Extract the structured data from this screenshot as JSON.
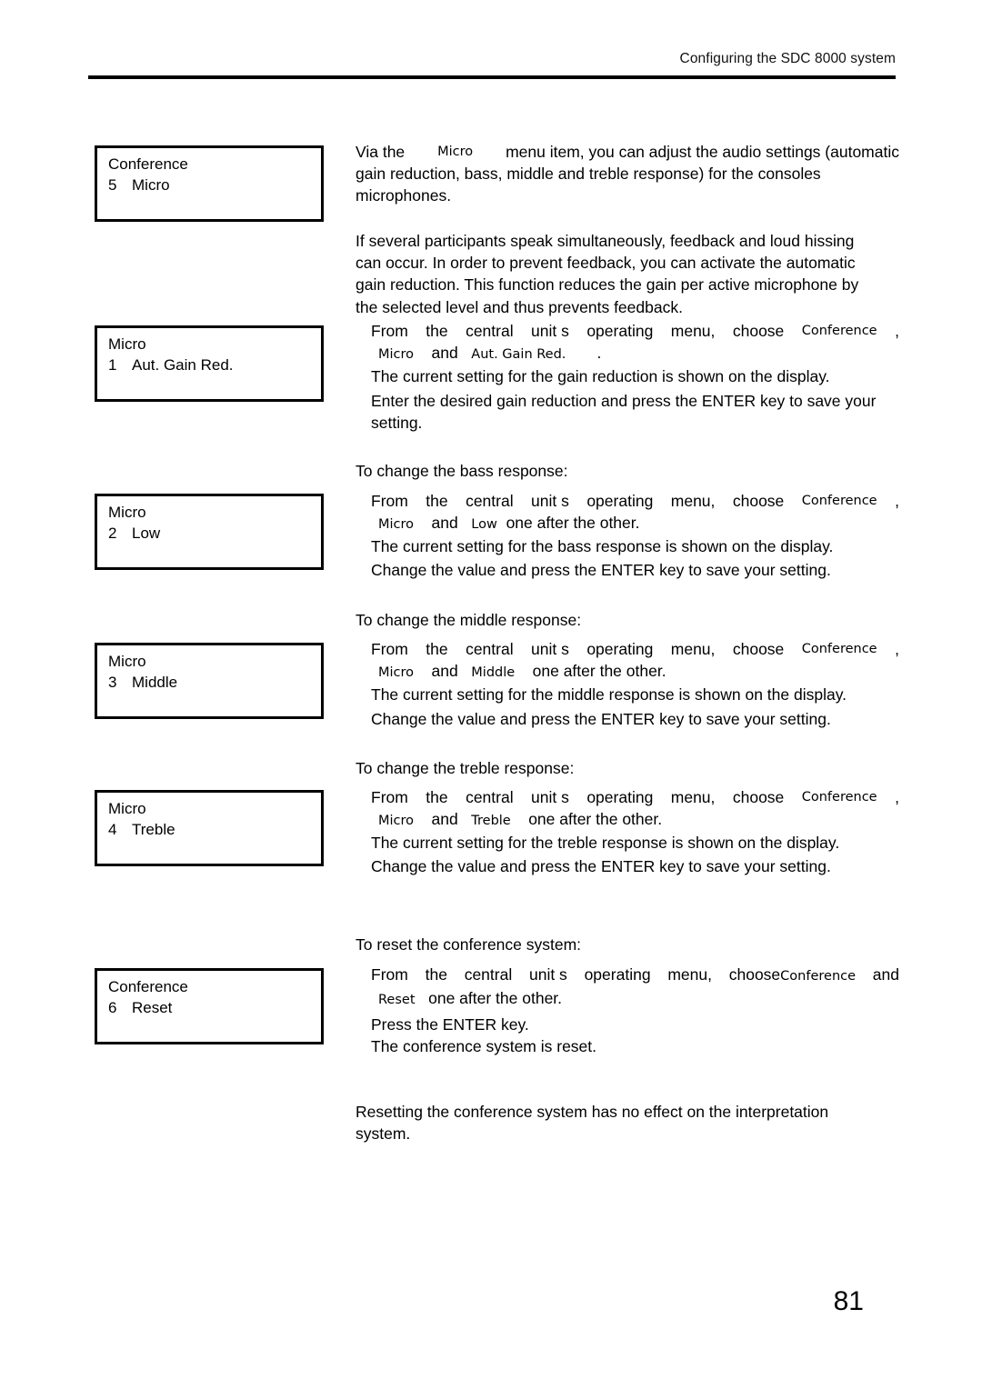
{
  "header": {
    "running_title": "Configuring the SDC 8000 system"
  },
  "page_number": "81",
  "displays": [
    {
      "name": "display-conference-micro",
      "line1": "Conference",
      "index": "5",
      "label": "Micro"
    },
    {
      "name": "display-micro-aut-gain-red",
      "line1": "Micro",
      "index": "1",
      "label": "Aut. Gain Red."
    },
    {
      "name": "display-micro-low",
      "line1": "Micro",
      "index": "2",
      "label": "Low"
    },
    {
      "name": "display-micro-middle",
      "line1": "Micro",
      "index": "3",
      "label": "Middle"
    },
    {
      "name": "display-micro-treble",
      "line1": "Micro",
      "index": "4",
      "label": "Treble"
    },
    {
      "name": "display-conference-reset",
      "line1": "Conference",
      "index": "6",
      "label": "Reset"
    }
  ],
  "menu_items": {
    "conference": "Conference",
    "micro": "Micro",
    "aut_gain_red": "Aut. Gain Red.",
    "low": "Low",
    "middle": "Middle",
    "treble": "Treble",
    "reset": "Reset"
  },
  "intro": {
    "l1_a": "Via the",
    "l1_mi": "Micro",
    "l1_b": "menu item, you can adjust the audio settings (automatic",
    "l2": "gain reduction, bass, middle and treble response) for the consoles",
    "l3": "microphones."
  },
  "feedback": {
    "l1": "If several participants speak simultaneously, feedback and loud hissing",
    "l2": "can occur. In order to prevent feedback, you can activate the automatic",
    "l3": "gain reduction. This function reduces the gain per active microphone by",
    "l4": "the selected level and thus prevents feedback."
  },
  "common": {
    "from_the": "From",
    "the": "the",
    "central": "central",
    "unit_s": "unit s",
    "operating": "operating",
    "menu_choose": "menu,",
    "choose": "choose",
    "and": "and",
    "one_after": "one after the other.",
    "period": ".",
    "comma": ","
  },
  "gain_section": {
    "step_line3": "The current setting for the gain reduction is shown on the display.",
    "enter_l1": "Enter the desired gain reduction and press the ENTER key to save your",
    "enter_l2": "setting."
  },
  "bass_section": {
    "heading": "To change the bass response:",
    "step_line3": "The current setting for the bass response is shown on the display.",
    "change_value": "Change the value and press the ENTER key to save your setting."
  },
  "middle_section": {
    "heading": "To change the middle response:",
    "step_line3": "The current setting for the middle response is shown on the display.",
    "change_value": "Change the value and press the ENTER key to save your setting."
  },
  "treble_section": {
    "heading": "To change the treble response:",
    "step_line3": "The current setting for the treble response is shown on the display.",
    "change_value": "Change the value and press the ENTER key to save your setting."
  },
  "reset_section": {
    "heading": "To reset the conference system:",
    "choose_word": "choose",
    "and_word": "and",
    "one_after": "one after the other.",
    "press_enter": "Press the ENTER key.",
    "is_reset": "The conference system is reset."
  },
  "note": {
    "l1": "Resetting the conference system has no effect on the interpretation",
    "l2": "system."
  }
}
